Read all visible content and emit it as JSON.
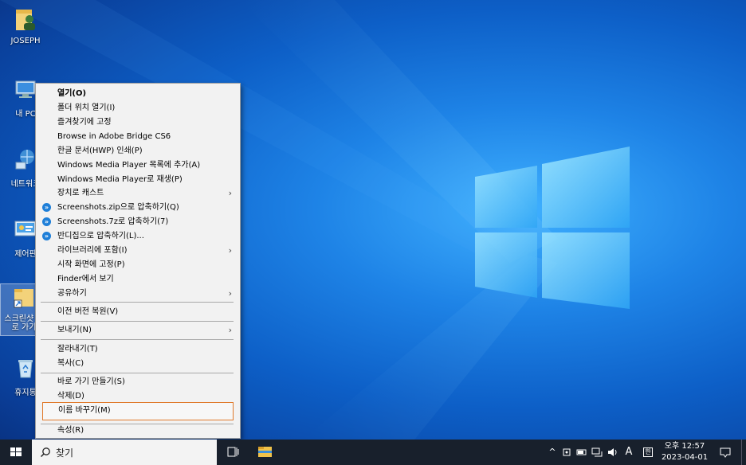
{
  "desktop_icons": [
    {
      "label": "JOSEPH"
    },
    {
      "label": "내 PC"
    },
    {
      "label": "네트워크"
    },
    {
      "label": "제어판"
    },
    {
      "label": "스크린샷 바로 가기"
    },
    {
      "label": "휴지통"
    }
  ],
  "context_menu": {
    "items": [
      {
        "label": "열기(O)",
        "bold": true
      },
      {
        "label": "폴더 위치 열기(I)"
      },
      {
        "label": "즐겨찾기에 고정"
      },
      {
        "label": "Browse in Adobe Bridge CS6"
      },
      {
        "label": "한글 문서(HWP) 인쇄(P)"
      },
      {
        "label": "Windows Media Player 목록에 추가(A)"
      },
      {
        "label": "Windows Media Player로 재생(P)"
      },
      {
        "label": "장치로 캐스트",
        "submenu": true
      },
      {
        "label": "Screenshots.zip으로 압축하기(Q)",
        "icon": "bandizip-icon"
      },
      {
        "label": "Screenshots.7z로 압축하기(7)",
        "icon": "bandizip-icon"
      },
      {
        "label": "반디집으로 압축하기(L)...",
        "icon": "bandizip-icon"
      },
      {
        "label": "라이브러리에 포함(I)",
        "submenu": true
      },
      {
        "label": "시작 화면에 고정(P)"
      },
      {
        "label": "Finder에서 보기"
      },
      {
        "label": "공유하기",
        "submenu": true
      },
      {
        "label": "이전 버전 복원(V)"
      },
      {
        "label": "보내기(N)",
        "submenu": true
      },
      {
        "label": "잘라내기(T)"
      },
      {
        "label": "복사(C)"
      },
      {
        "label": "바로 가기 만들기(S)"
      },
      {
        "label": "삭제(D)"
      },
      {
        "label": "이름 바꾸기(M)",
        "highlighted": true
      },
      {
        "label": "속성(R)"
      }
    ]
  },
  "taskbar": {
    "search_label": "찾기",
    "input_indicator": "A",
    "ime_label": "한",
    "time": "오후 12:57",
    "date": "2023-04-01"
  },
  "colors": {
    "highlight_border": "#e07a2c",
    "taskbar": "#18202c"
  }
}
